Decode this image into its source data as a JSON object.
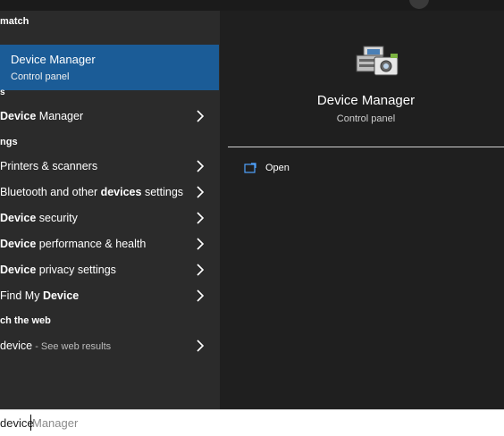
{
  "sections": {
    "best_match": "match",
    "apps": "s",
    "settings": "ngs",
    "web": "ch the web"
  },
  "best_match_item": {
    "title": "Device Manager",
    "subtitle": "Control panel"
  },
  "apps": [
    {
      "bold": "Device",
      "rest": " Manager"
    }
  ],
  "settings": [
    {
      "pre": "Printers & scanners",
      "bold": "",
      "rest": ""
    },
    {
      "pre": "Bluetooth and other ",
      "bold": "devices",
      "rest": " settings"
    },
    {
      "pre": "",
      "bold": "Device",
      "rest": " security"
    },
    {
      "pre": "",
      "bold": "Device",
      "rest": " performance & health"
    },
    {
      "pre": "",
      "bold": "Device",
      "rest": " privacy settings"
    },
    {
      "pre": "Find My ",
      "bold": "Device",
      "rest": ""
    }
  ],
  "web_result": {
    "term": "device",
    "suffix": " - See web results"
  },
  "preview": {
    "title": "Device Manager",
    "subtitle": "Control panel",
    "action_open": "Open",
    "icon": "device-manager-icon"
  },
  "search": {
    "typed": "device",
    "completion": " Manager"
  },
  "colors": {
    "accent": "#1b5c97",
    "left_panel": "#2b2b2b",
    "right_panel": "#1f1f1f"
  }
}
